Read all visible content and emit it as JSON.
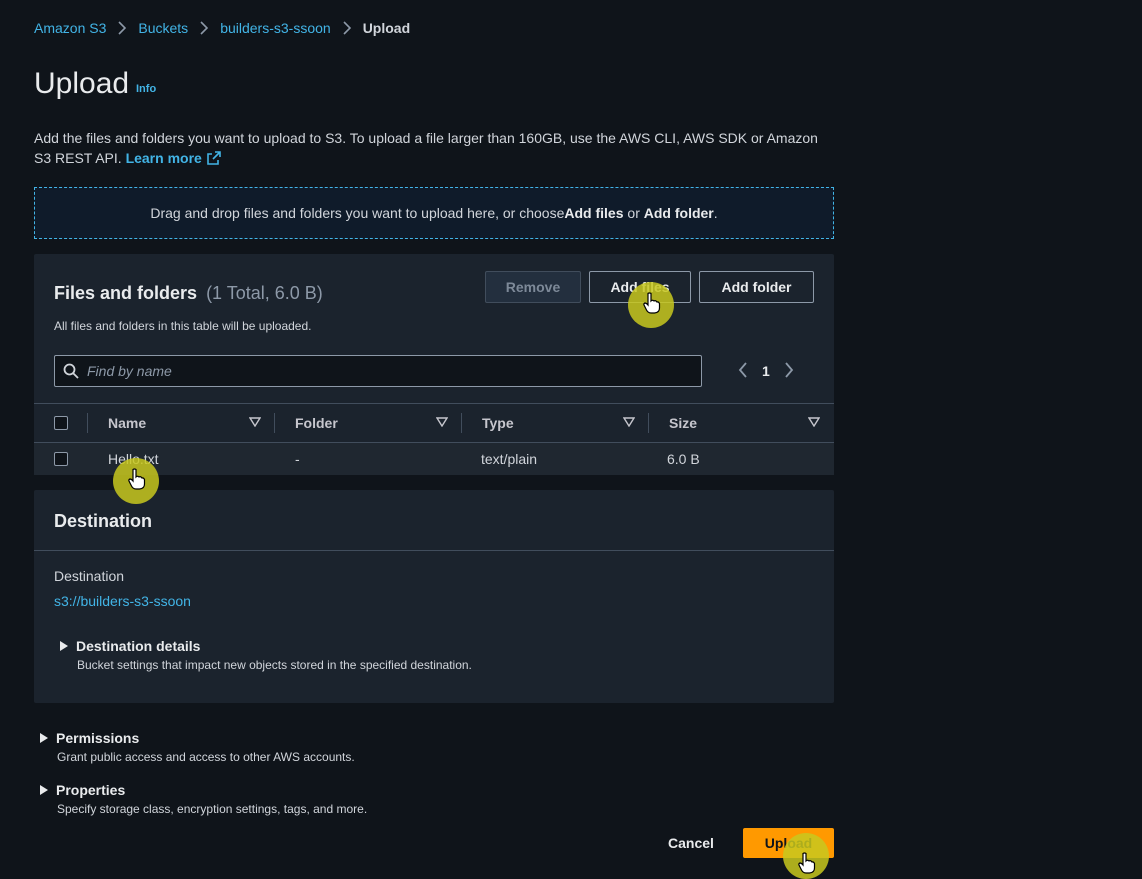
{
  "breadcrumb": {
    "items": [
      "Amazon S3",
      "Buckets",
      "builders-s3-ssoon"
    ],
    "current": "Upload"
  },
  "page": {
    "title": "Upload",
    "info": "Info",
    "description": "Add the files and folders you want to upload to S3. To upload a file larger than 160GB, use the AWS CLI, AWS SDK or Amazon S3 REST API.",
    "learn_more": "Learn more"
  },
  "dropzone": {
    "text_before": "Drag and drop files and folders you want to upload here, or choose ",
    "add_files": "Add files",
    "or": " or ",
    "add_folder": "Add folder",
    "period": "."
  },
  "files_panel": {
    "title": "Files and folders",
    "count": "(1 Total, 6.0 B)",
    "subtitle": "All files and folders in this table will be uploaded.",
    "remove_label": "Remove",
    "add_files_label": "Add files",
    "add_folder_label": "Add folder",
    "search_placeholder": "Find by name",
    "page_number": "1",
    "columns": [
      "Name",
      "Folder",
      "Type",
      "Size"
    ],
    "rows": [
      {
        "name": "Hello.txt",
        "folder": "-",
        "type": "text/plain",
        "size": "6.0 B"
      }
    ]
  },
  "destination": {
    "title": "Destination",
    "label": "Destination",
    "path": "s3://builders-s3-ssoon",
    "details_title": "Destination details",
    "details_desc": "Bucket settings that impact new objects stored in the specified destination."
  },
  "permissions": {
    "title": "Permissions",
    "desc": "Grant public access and access to other AWS accounts."
  },
  "properties": {
    "title": "Properties",
    "desc": "Specify storage class, encryption settings, tags, and more."
  },
  "actions": {
    "cancel": "Cancel",
    "upload": "Upload"
  },
  "colors": {
    "background": "#0f141a",
    "panel": "#1b232d",
    "link": "#42b4e6",
    "primary_button": "#ff9900",
    "cursor_highlight": "#c8c81e"
  }
}
